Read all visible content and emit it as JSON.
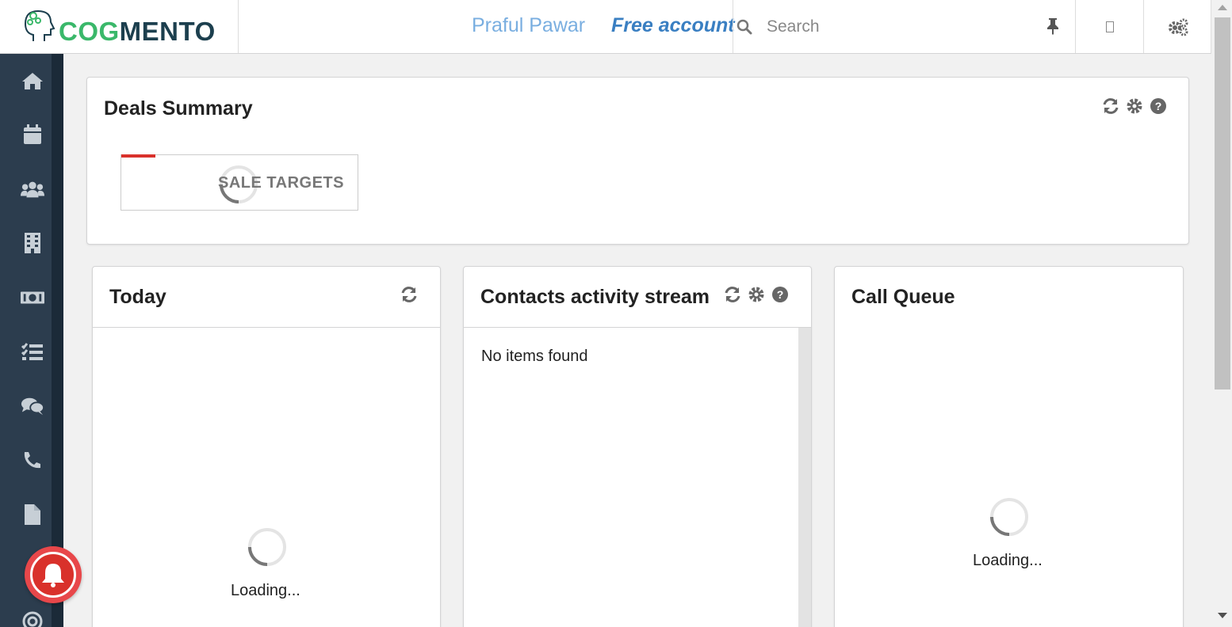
{
  "app": {
    "brand_part1": "COG",
    "brand_part2": "MENTO",
    "brand_colors": {
      "cog": "#3ab86a",
      "mento": "#1c3f4e"
    }
  },
  "header": {
    "user_name": "Praful Pawar",
    "account_type": "Free account",
    "search_placeholder": "Search",
    "icons": [
      "search-icon",
      "pin-icon",
      "message-icon",
      "settings-cogs-icon"
    ]
  },
  "sidebar": {
    "items": [
      {
        "name": "home",
        "icon": "home-icon"
      },
      {
        "name": "calendar",
        "icon": "calendar-icon"
      },
      {
        "name": "contacts",
        "icon": "users-icon"
      },
      {
        "name": "companies",
        "icon": "building-icon"
      },
      {
        "name": "deals",
        "icon": "money-icon"
      },
      {
        "name": "tasks",
        "icon": "tasks-icon"
      },
      {
        "name": "cases",
        "icon": "comments-icon"
      },
      {
        "name": "calls",
        "icon": "phone-icon"
      },
      {
        "name": "documents",
        "icon": "file-icon"
      },
      {
        "name": "campaigns",
        "icon": "target-icon"
      }
    ]
  },
  "deals_summary": {
    "title": "Deals Summary",
    "sale_targets_label": "SALE TARGETS",
    "accent_color": "#d9312b"
  },
  "today": {
    "title": "Today",
    "loading_text": "Loading..."
  },
  "contacts_activity": {
    "title": "Contacts activity stream",
    "empty_text": "No items found"
  },
  "call_queue": {
    "title": "Call Queue",
    "loading_text": "Loading..."
  },
  "colors": {
    "sidebar_bg": "#2c3d4e",
    "user_name": "#79aee0",
    "account_type": "#3a7fc2",
    "bell": "#d9312b"
  }
}
